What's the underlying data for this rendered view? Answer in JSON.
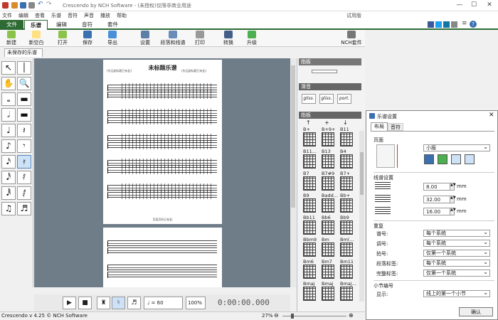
{
  "app": {
    "title": "Crescendo by NCH Software - (未授权)仅限非商业用途",
    "menu_right": "试用版",
    "menu": [
      "文件",
      "编辑",
      "查看",
      "乐谱",
      "音符",
      "声音",
      "播放",
      "帮助"
    ],
    "tabs": [
      "文件",
      "乐谱",
      "编辑",
      "音符",
      "套件"
    ],
    "active_tab": "乐谱"
  },
  "ribbon": [
    {
      "label": "新建",
      "icon": "new-document-icon"
    },
    {
      "label": "新空白",
      "icon": "new-blank-icon"
    },
    {
      "label": "打开",
      "icon": "open-folder-icon"
    },
    {
      "label": "保存",
      "icon": "save-disk-icon"
    },
    {
      "label": "导出",
      "icon": "export-icon"
    },
    {
      "label": "设置",
      "icon": "settings-icon"
    },
    {
      "label": "段落和线谱",
      "icon": "staves-icon"
    },
    {
      "label": "打印",
      "icon": "printer-icon"
    },
    {
      "label": "转换",
      "icon": "convert-icon"
    },
    {
      "label": "升级",
      "icon": "upgrade-icon"
    },
    {
      "label": "NCH套件",
      "icon": "nch-suite-icon"
    }
  ],
  "document_tab": "未保存的乐谱",
  "score": {
    "title": "未标题乐谱",
    "left_sub": "(作品副标题已有此)",
    "right_sub": "(作品副标题已有此)",
    "footer": "页面页码已有此"
  },
  "tools": [
    "↖",
    "│",
    "✋",
    "🔍",
    "𝅝",
    "▬",
    "𝅗𝅥",
    "▬",
    "♩",
    "𝄽",
    "♪",
    "𝄾",
    "𝅘𝅥𝅯",
    "𝄿",
    "𝅘𝅥𝅰",
    "𝅀",
    "𝅘𝅥𝅱",
    "𝅁",
    "♫",
    "♬"
  ],
  "right_panel": {
    "top_header": "指板",
    "ornaments_header": "滑音",
    "ornaments": [
      "gliss.",
      "gliss.",
      "port."
    ],
    "chords_header": "指板",
    "chords": [
      "B+",
      "B+9+",
      "B11",
      "B11...",
      "B13",
      "B4",
      "B7",
      "B7#9",
      "B7+",
      "B9",
      "Badd...",
      "Bb+",
      "Bb11",
      "Bb6",
      "Bb9",
      "Bbm9",
      "Bm",
      "Bm(...",
      "Bm6",
      "Bm7",
      "Bm11",
      "Bmaj",
      "Bmaj",
      "Bmaj..."
    ]
  },
  "playback": {
    "tempo": "= 60",
    "zoom": "100%",
    "time": "0:00:00.000"
  },
  "status": {
    "version": "Crescendo v 4.25 © NCH Software",
    "zoom": "27%"
  },
  "dialog": {
    "title": "乐谱设置",
    "tabs": [
      "布局",
      "音符"
    ],
    "active_tab": "布局",
    "page_section": "页面",
    "page_size": "小报",
    "staff_section": "线谱设置",
    "spacing": [
      {
        "value": "8.00",
        "unit": "mm"
      },
      {
        "value": "32.00",
        "unit": "mm"
      },
      {
        "value": "16.00",
        "unit": "mm"
      }
    ],
    "repeat_section": "重复",
    "repeat_rows": [
      {
        "label": "谱号:",
        "value": "每个系统"
      },
      {
        "label": "调号:",
        "value": "每个系统"
      },
      {
        "label": "拍号:",
        "value": "仅第一个系统"
      },
      {
        "label": "段落标签:",
        "value": "每个系统"
      },
      {
        "label": "完整标签:",
        "value": "仅第一个系统"
      }
    ],
    "bar_section": "小节编号",
    "display_label": "显示:",
    "display_value": "线上的第一个小节",
    "ok": "确认"
  },
  "colors": {
    "accent": "#2e6b34",
    "canvas": "#6f7d89",
    "panel_header": "#666666"
  }
}
